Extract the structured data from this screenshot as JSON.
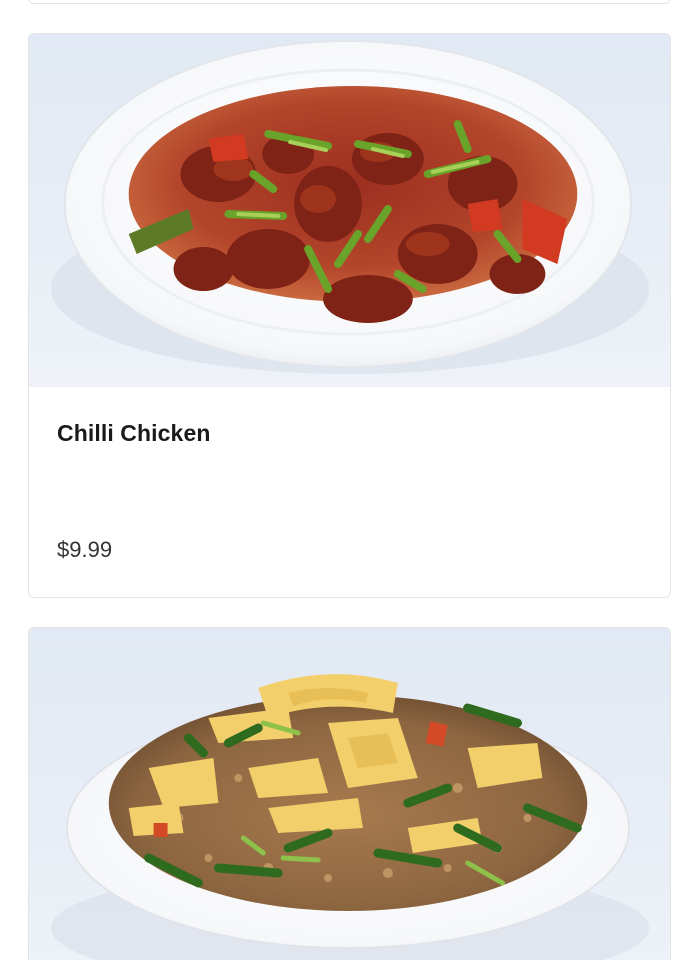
{
  "menu_items": [
    {
      "name": "Chilli Chicken",
      "price": "$9.99",
      "image": "chilli-chicken-plate"
    },
    {
      "image": "fried-rice-plate"
    }
  ]
}
